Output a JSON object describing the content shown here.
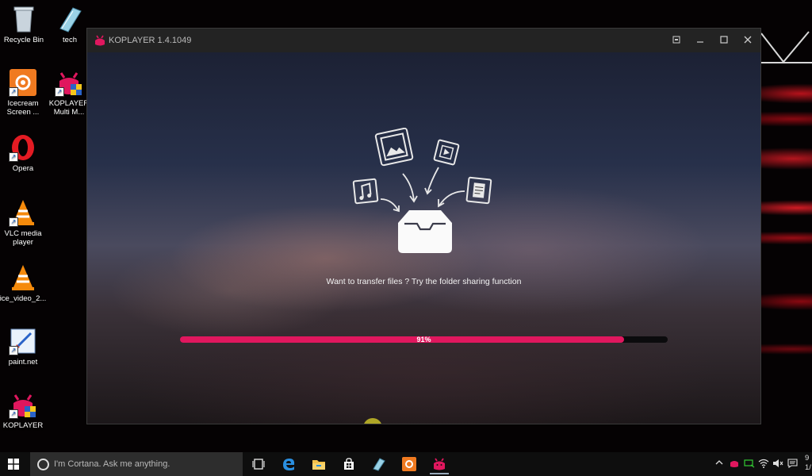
{
  "desktop": {
    "icons": [
      {
        "label": "Recycle Bin"
      },
      {
        "label": "tech"
      },
      {
        "label": "Icecream Screen ..."
      },
      {
        "label": "KOPLAYER Multi M..."
      },
      {
        "label": "Opera"
      },
      {
        "label": "VLC media player"
      },
      {
        "label": "ice_video_2..."
      },
      {
        "label": "paint.net"
      },
      {
        "label": "KOPLAYER"
      }
    ]
  },
  "window": {
    "title": "KOPLAYER 1.4.1049",
    "message": "Want to transfer files ? Try the folder sharing function",
    "progress": {
      "value": 0.91,
      "label": "91%"
    },
    "accent_color": "#e0175e",
    "transfer_icons": [
      "music-icon",
      "image-icon",
      "video-icon",
      "document-icon",
      "inbox-icon"
    ]
  },
  "taskbar": {
    "search_placeholder": "I'm Cortana. Ask me anything.",
    "apps": [
      "task-view-icon",
      "edge-icon",
      "file-explorer-icon",
      "store-icon",
      "tech-app-icon",
      "icecream-icon",
      "koplayer-icon"
    ],
    "clock_partial": "9",
    "date_partial": "1/"
  }
}
